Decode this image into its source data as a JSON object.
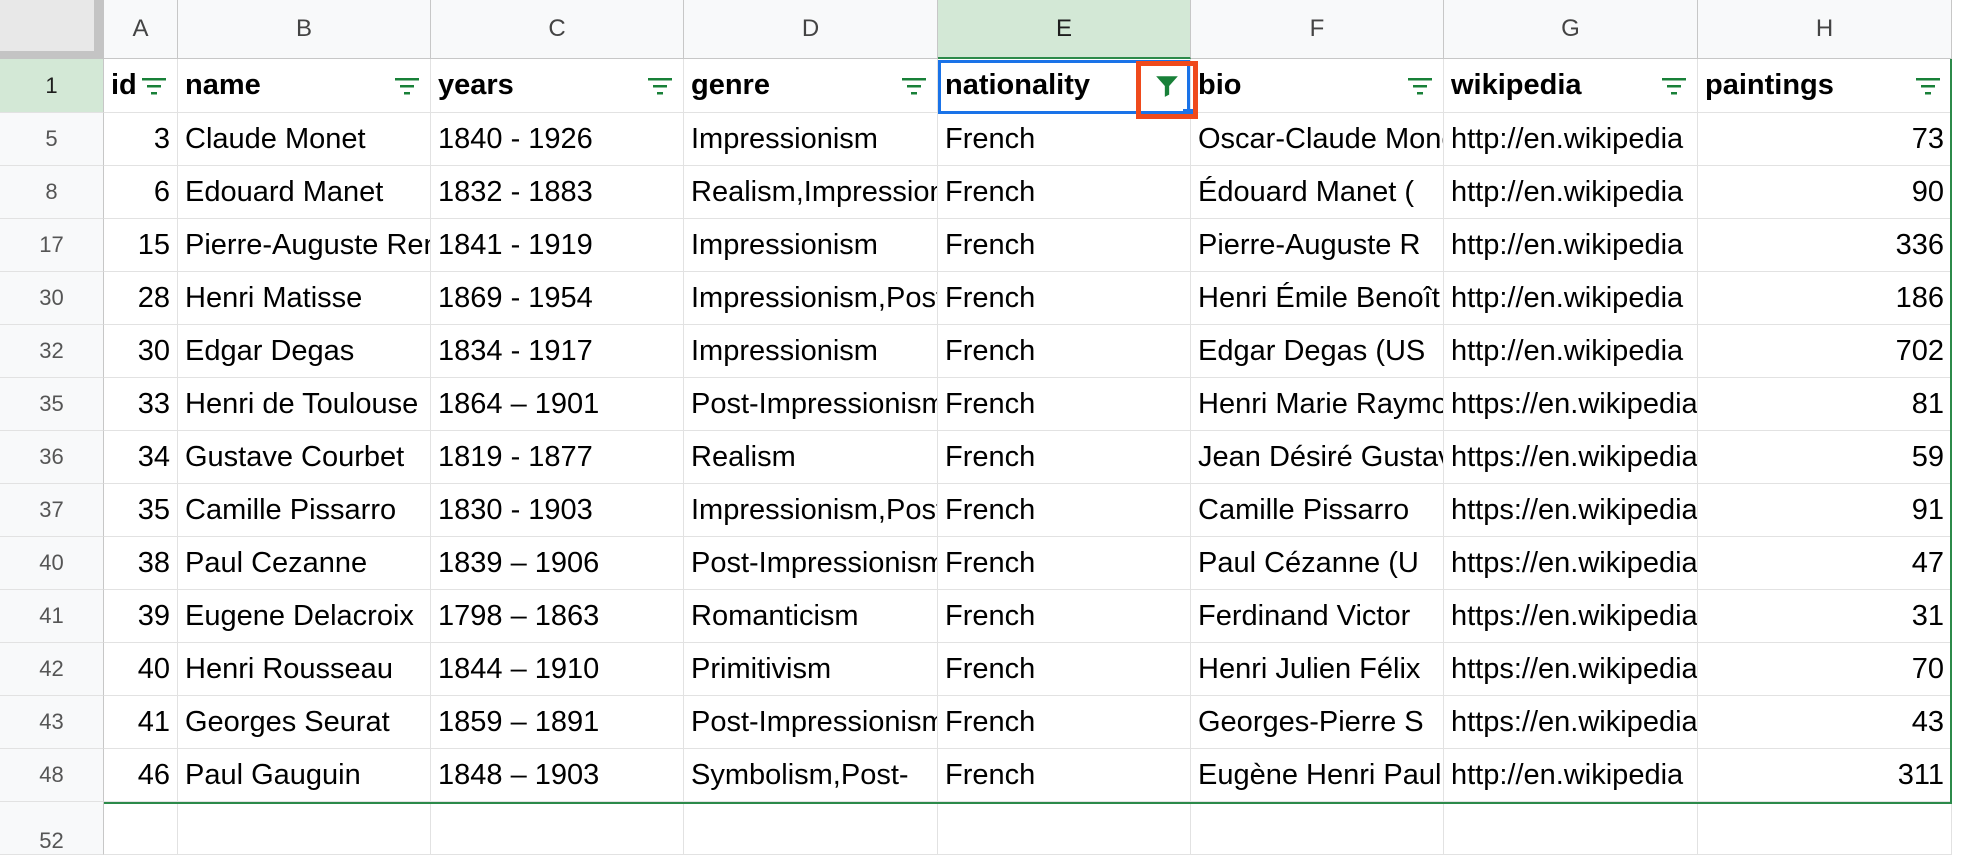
{
  "columns": [
    {
      "letter": "A",
      "header": "id"
    },
    {
      "letter": "B",
      "header": "name"
    },
    {
      "letter": "C",
      "header": "years"
    },
    {
      "letter": "D",
      "header": "genre"
    },
    {
      "letter": "E",
      "header": "nationality"
    },
    {
      "letter": "F",
      "header": "bio"
    },
    {
      "letter": "G",
      "header": "wikipedia"
    },
    {
      "letter": "H",
      "header": "paintings"
    }
  ],
  "header_row_number": "1",
  "rows": [
    {
      "num": "5",
      "cells": [
        "3",
        "Claude Monet",
        "1840 - 1926",
        "Impressionism",
        "French",
        "Oscar-Claude Monet",
        "http://en.wikipedia",
        "73"
      ]
    },
    {
      "num": "8",
      "cells": [
        "6",
        "Edouard Manet",
        "1832 - 1883",
        "Realism,Impressionism",
        "French",
        "Édouard Manet (",
        "http://en.wikipedia",
        "90"
      ]
    },
    {
      "num": "17",
      "cells": [
        "15",
        "Pierre-Auguste Renoir",
        "1841 - 1919",
        "Impressionism",
        "French",
        "Pierre-Auguste R",
        "http://en.wikipedia",
        "336"
      ]
    },
    {
      "num": "30",
      "cells": [
        "28",
        "Henri Matisse",
        "1869 - 1954",
        "Impressionism,Post",
        "French",
        "Henri Émile Benoît",
        "http://en.wikipedia",
        "186"
      ]
    },
    {
      "num": "32",
      "cells": [
        "30",
        "Edgar Degas",
        "1834 - 1917",
        "Impressionism",
        "French",
        "Edgar Degas (US",
        "http://en.wikipedia",
        "702"
      ]
    },
    {
      "num": "35",
      "cells": [
        "33",
        "Henri de Toulouse",
        "1864 – 1901",
        "Post-Impressionism",
        "French",
        "Henri Marie Raymond",
        "https://en.wikipedia",
        "81"
      ]
    },
    {
      "num": "36",
      "cells": [
        "34",
        "Gustave Courbet",
        "1819 - 1877",
        "Realism",
        "French",
        "Jean Désiré Gustave",
        "https://en.wikipedia",
        "59"
      ]
    },
    {
      "num": "37",
      "cells": [
        "35",
        "Camille Pissarro",
        "1830 - 1903",
        "Impressionism,Post",
        "French",
        "Camille Pissarro",
        "https://en.wikipedia",
        "91"
      ]
    },
    {
      "num": "40",
      "cells": [
        "38",
        "Paul Cezanne",
        "1839 – 1906",
        "Post-Impressionism",
        "French",
        "Paul Cézanne (U",
        "https://en.wikipedia",
        "47"
      ]
    },
    {
      "num": "41",
      "cells": [
        "39",
        "Eugene Delacroix",
        "1798 – 1863",
        "Romanticism",
        "French",
        "Ferdinand Victor",
        "https://en.wikipedia",
        "31"
      ]
    },
    {
      "num": "42",
      "cells": [
        "40",
        "Henri Rousseau",
        "1844 – 1910",
        "Primitivism",
        "French",
        "Henri Julien Félix",
        "https://en.wikipedia",
        "70"
      ]
    },
    {
      "num": "43",
      "cells": [
        "41",
        "Georges Seurat",
        "1859 – 1891",
        "Post-Impressionism",
        "French",
        "Georges-Pierre S",
        "https://en.wikipedia",
        "43"
      ]
    },
    {
      "num": "48",
      "cells": [
        "46",
        "Paul Gauguin",
        "1848 – 1903",
        "Symbolism,Post-",
        "French",
        "Eugène Henri Paul",
        "http://en.wikipedia",
        "311"
      ]
    }
  ],
  "next_row_number": "52",
  "colors": {
    "filter_icon": "#188038",
    "active_filter": "#188038",
    "highlight": "#ef4a1c",
    "selection": "#1a73e8"
  },
  "icons": {
    "filter": "filter-icon",
    "active_filter": "funnel-filled-icon"
  }
}
